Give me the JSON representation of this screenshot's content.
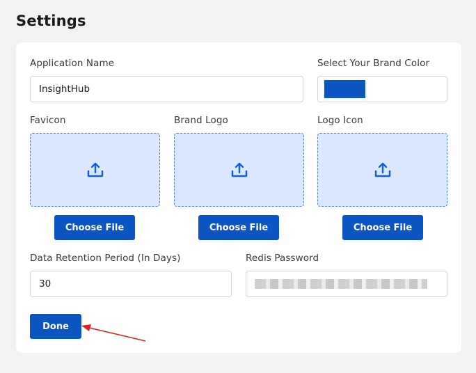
{
  "page": {
    "title": "Settings"
  },
  "form": {
    "app_name_label": "Application Name",
    "app_name_value": "InsightHub",
    "brand_color_label": "Select Your Brand Color",
    "brand_color_value": "#0b55c2",
    "favicon_label": "Favicon",
    "brand_logo_label": "Brand Logo",
    "logo_icon_label": "Logo Icon",
    "upload_icon": "upload-icon",
    "choose_file_label": "Choose File",
    "retention_label": "Data Retention Period (In Days)",
    "retention_value": "30",
    "redis_password_label": "Redis Password",
    "done_label": "Done"
  },
  "colors": {
    "accent": "#0b55c2",
    "upload_zone_bg": "#dbe8ff",
    "annotation_arrow": "#e02020"
  }
}
